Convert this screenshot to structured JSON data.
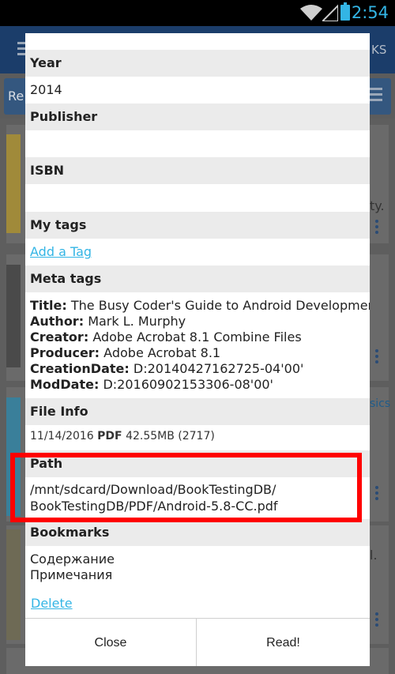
{
  "status_bar": {
    "time": "2:54"
  },
  "background": {
    "tab_text": "KS",
    "toolbar_text": "Re",
    "side_text_1": "ty.",
    "side_text_2": "sics",
    "side_text_3": "l."
  },
  "dialog": {
    "year": {
      "label": "Year",
      "value": "2014"
    },
    "publisher": {
      "label": "Publisher",
      "value": ""
    },
    "isbn": {
      "label": "ISBN",
      "value": ""
    },
    "my_tags": {
      "label": "My tags",
      "add_link": "Add a Tag"
    },
    "meta_tags": {
      "label": "Meta tags",
      "items": [
        {
          "key": "Title:",
          "value": "The Busy Coder's Guide to Android Development"
        },
        {
          "key": "Author:",
          "value": "Mark L. Murphy"
        },
        {
          "key": "Creator:",
          "value": "Adobe Acrobat 8.1 Combine Files"
        },
        {
          "key": "Producer:",
          "value": "Adobe Acrobat 8.1"
        },
        {
          "key": "CreationDate:",
          "value": "D:20140427162725-04'00'"
        },
        {
          "key": "ModDate:",
          "value": "D:20160902153306-08'00'"
        }
      ]
    },
    "file_info": {
      "label": "File Info",
      "date": "11/14/2016",
      "format": "PDF",
      "size": "42.55MB (2717)"
    },
    "path": {
      "label": "Path",
      "line1": "/mnt/sdcard/Download/BookTestingDB/",
      "line2": "BookTestingDB/PDF/Android-5.8-CC.pdf"
    },
    "bookmarks": {
      "label": "Bookmarks",
      "items": [
        "Содержание",
        "Примечания"
      ],
      "delete_link": "Delete"
    },
    "buttons": {
      "close": "Close",
      "read": "Read!"
    }
  },
  "colors": {
    "link": "#33b5e5",
    "highlight": "#ff0000",
    "header_bg": "#ebebeb"
  }
}
